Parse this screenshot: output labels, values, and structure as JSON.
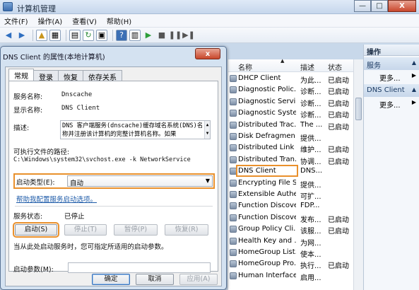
{
  "window": {
    "title": "计算机管理",
    "btn_min": "—",
    "btn_max": "□",
    "btn_close": "X"
  },
  "menu": [
    "文件(F)",
    "操作(A)",
    "查看(V)",
    "帮助(H)"
  ],
  "services": {
    "columns": {
      "name": "名称",
      "desc": "描述",
      "status": "状态"
    },
    "rows": [
      {
        "name": "DHCP Client",
        "desc": "为此...",
        "status": "已启动"
      },
      {
        "name": "Diagnostic Polic...",
        "desc": "诊断...",
        "status": "已启动"
      },
      {
        "name": "Diagnostic Servi...",
        "desc": "诊断...",
        "status": "已启动"
      },
      {
        "name": "Diagnostic Syste...",
        "desc": "诊断...",
        "status": "已启动"
      },
      {
        "name": "Distributed Trac...",
        "desc": "The ...",
        "status": "已启动"
      },
      {
        "name": "Disk Defragmen...",
        "desc": "提供...",
        "status": ""
      },
      {
        "name": "Distributed Link ...",
        "desc": "维护...",
        "status": "已启动"
      },
      {
        "name": "Distributed Tran...",
        "desc": "协调...",
        "status": "已启动"
      },
      {
        "name": "DNS Client",
        "desc": "DNS...",
        "status": ""
      },
      {
        "name": "Encrypting File S...",
        "desc": "提供...",
        "status": ""
      },
      {
        "name": "Extensible Authe...",
        "desc": "可扩...",
        "status": ""
      },
      {
        "name": "Function Discove...",
        "desc": "FDP...",
        "status": ""
      },
      {
        "name": "Function Discove...",
        "desc": "发布...",
        "status": "已启动"
      },
      {
        "name": "Group Policy Cli...",
        "desc": "该服...",
        "status": "已启动"
      },
      {
        "name": "Health Key and ...",
        "desc": "为网...",
        "status": ""
      },
      {
        "name": "HomeGroup List...",
        "desc": "使本...",
        "status": ""
      },
      {
        "name": "HomeGroup Pro...",
        "desc": "执行...",
        "status": "已启动"
      },
      {
        "name": "Human Interface...",
        "desc": "启用...",
        "status": ""
      }
    ]
  },
  "actions": {
    "header": "操作",
    "sections": [
      {
        "title": "服务",
        "more": "更多..."
      },
      {
        "title": "DNS Client",
        "more": "更多..."
      }
    ]
  },
  "dialog": {
    "title": "DNS Client 的属性(本地计算机)",
    "close": "x",
    "tabs": [
      "常规",
      "登录",
      "恢复",
      "依存关系"
    ],
    "service_name_label": "服务名称:",
    "service_name": "Dnscache",
    "display_name_label": "显示名称:",
    "display_name": "DNS Client",
    "description_label": "描述:",
    "description": "DNS 客户端服务(dnscache)缓存域名系统(DNS)名称并注册该计算机的完整计算机名称。如果",
    "exe_path_label": "可执行文件的路径:",
    "exe_path": "C:\\Windows\\system32\\svchost.exe -k NetworkService",
    "startup_type_label": "启动类型(E):",
    "startup_type": "自动",
    "help_link": "帮助我配置服务启动选项。",
    "status_label": "服务状态:",
    "status_value": "已停止",
    "btn_start": "启动(S)",
    "btn_stop": "停止(T)",
    "btn_pause": "暂停(P)",
    "btn_resume": "恢复(R)",
    "start_hint": "当从此处启动服务时，您可指定所适用的启动参数。",
    "start_params_label": "启动参数(M):",
    "btn_ok": "确定",
    "btn_cancel": "取消",
    "btn_apply": "应用(A)"
  }
}
